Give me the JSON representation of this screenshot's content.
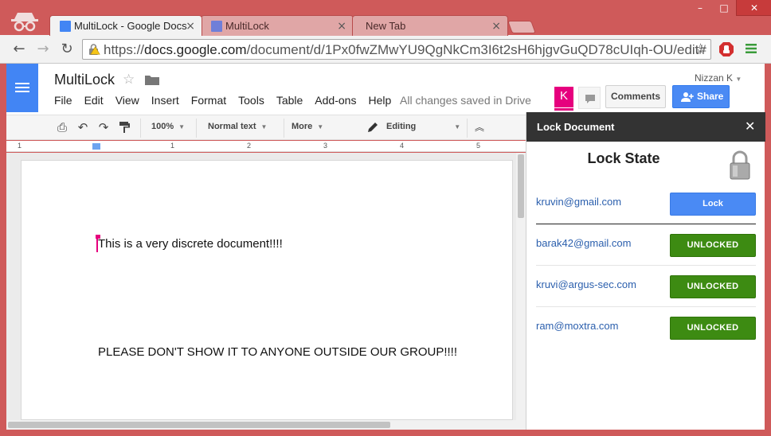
{
  "browser": {
    "tabs": [
      {
        "title": "MultiLock - Google Docs",
        "active": true
      },
      {
        "title": "MultiLock",
        "active": false
      },
      {
        "title": "New Tab",
        "active": false
      }
    ],
    "tab_close": "×",
    "window_controls": {
      "minimize": "–",
      "maximize": "□",
      "close": "✕"
    },
    "url_prefix": "https://",
    "url_host": "docs.google.com",
    "url_path": "/document/d/1Px0fwZMwYU9QgNkCm3I6t2sH6hjgvGuQD78cUIqh-OU/edit#"
  },
  "docs": {
    "title": "MultiLock",
    "menu": [
      "File",
      "Edit",
      "View",
      "Insert",
      "Format",
      "Tools",
      "Table",
      "Add-ons",
      "Help"
    ],
    "save_status": "All changes saved in Drive",
    "user_name": "Nizzan K",
    "avatar_letter": "K",
    "comments_label": "Comments",
    "share_label": "Share"
  },
  "toolbar": {
    "zoom": "100%",
    "style": "Normal text",
    "more": "More",
    "mode": "Editing"
  },
  "ruler": {
    "numbers": [
      "1",
      "1",
      "2",
      "3",
      "4",
      "5"
    ]
  },
  "document": {
    "line1": "This is a very discrete document!!!!",
    "line2": "PLEASE DON'T SHOW IT TO ANYONE OUTSIDE OUR GROUP!!!!"
  },
  "panel": {
    "title": "Lock Document",
    "close": "✕",
    "heading": "Lock State",
    "current_user": {
      "email": "kruvin@gmail.com",
      "button": "Lock"
    },
    "others": [
      {
        "email": "barak42@gmail.com",
        "status": "UNLOCKED"
      },
      {
        "email": "kruvi@argus-sec.com",
        "status": "UNLOCKED"
      },
      {
        "email": "ram@moxtra.com",
        "status": "UNLOCKED"
      }
    ]
  },
  "colors": {
    "window": "#cf5a5a",
    "docs_blue": "#4285f4",
    "unlocked_green": "#3d8b12",
    "lock_blue": "#4a8af4",
    "cursor_pink": "#e6007e"
  }
}
